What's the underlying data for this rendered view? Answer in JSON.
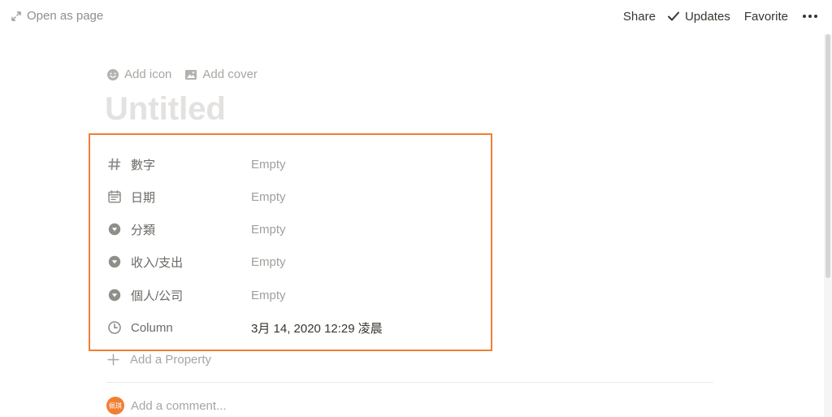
{
  "topbar": {
    "open_as_page": "Open as page",
    "share": "Share",
    "updates": "Updates",
    "favorite": "Favorite",
    "more_icon": "more-horizontal-icon"
  },
  "page": {
    "add_icon": "Add icon",
    "add_cover": "Add cover",
    "title_placeholder": "Untitled"
  },
  "properties": [
    {
      "icon": "hash-icon",
      "name": "數字",
      "value": "Empty",
      "filled": false
    },
    {
      "icon": "calendar-icon",
      "name": "日期",
      "value": "Empty",
      "filled": false
    },
    {
      "icon": "select-icon",
      "name": "分類",
      "value": "Empty",
      "filled": false
    },
    {
      "icon": "select-icon",
      "name": "收入/支出",
      "value": "Empty",
      "filled": false
    },
    {
      "icon": "select-icon",
      "name": "個人/公司",
      "value": "Empty",
      "filled": false
    },
    {
      "icon": "clock-icon",
      "name": "Column",
      "value": "3月 14, 2020 12:29 凌晨",
      "filled": true
    }
  ],
  "add_property": "Add a Property",
  "comment": {
    "avatar_text": "佩琪",
    "placeholder": "Add a comment..."
  },
  "colors": {
    "highlight_border": "#f07f34",
    "avatar_bg": "#f07f34"
  }
}
